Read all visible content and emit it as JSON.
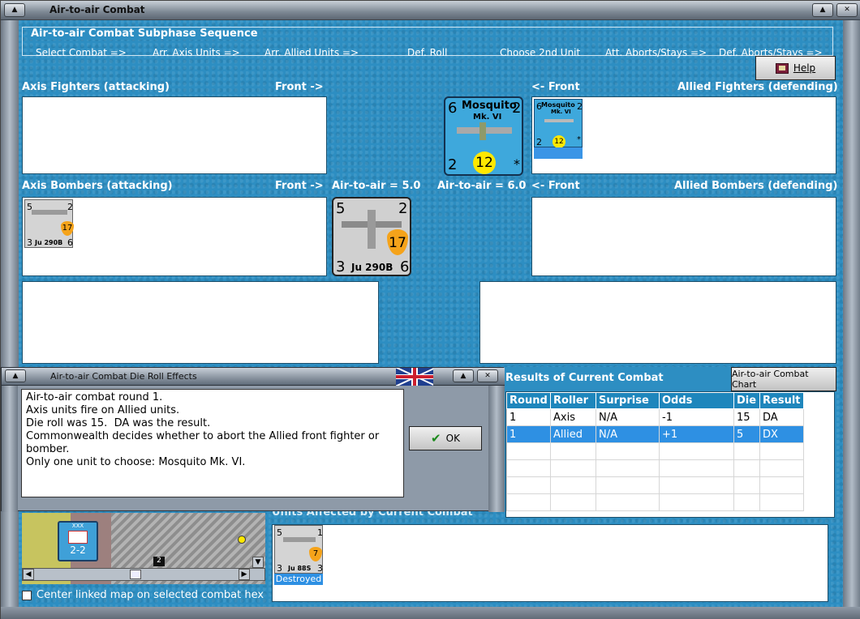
{
  "window": {
    "title": "Air-to-air Combat"
  },
  "sequence": {
    "legend": "Air-to-air Combat Subphase Sequence",
    "steps": [
      "Select Combat =>",
      "Arr. Axis Units =>",
      "Arr. Allied Units =>",
      "Def. Roll",
      "Choose 2nd Unit",
      "Att. Aborts/Stays =>",
      "Def. Aborts/Stays =>"
    ]
  },
  "help": {
    "label": "Help"
  },
  "axis_fighters": {
    "label": "Axis Fighters (attacking)",
    "front": "Front ->"
  },
  "allied_fighters": {
    "label": "Allied Fighters (defending)",
    "front": "<- Front"
  },
  "axis_bombers": {
    "label": "Axis Bombers (attacking)",
    "front": "Front ->",
    "air_to_air": "Air-to-air = 5.0"
  },
  "allied_bombers": {
    "label": "Allied Bombers (defending)",
    "front": "<- Front",
    "air_to_air": "Air-to-air = 6.0"
  },
  "mosquito": {
    "name": "Mosquito",
    "model": "Mk. VI",
    "tl": "6",
    "tr": "2",
    "bl": "2",
    "center": "12",
    "br": "*"
  },
  "ju290": {
    "name": "Ju 290B",
    "tl": "5",
    "tr": "2",
    "bl": "3",
    "center": "17",
    "br": "6"
  },
  "ju88": {
    "name": "Ju 88S",
    "tl": "5",
    "tr": "1",
    "bl": "3",
    "center": "7",
    "br": "3",
    "status": "Destroyed"
  },
  "dialog": {
    "title": "Air-to-air Combat Die Roll Effects",
    "lines": [
      "Air-to-air combat round 1.",
      "Axis units fire on Allied units.",
      "Die roll was 15.  DA was the result.",
      "Commonwealth decides whether to abort the Allied front fighter or bomber.",
      "Only one unit to choose: Mosquito Mk. VI."
    ],
    "ok_label": "OK"
  },
  "results": {
    "title": "Results of Current Combat",
    "chart_button": "Air-to-air Combat Chart",
    "columns": [
      "Round",
      "Roller",
      "Surprise",
      "Odds",
      "Die",
      "Result"
    ],
    "rows": [
      [
        "1",
        "Axis",
        "N/A",
        "-1",
        "15",
        "DA"
      ],
      [
        "1",
        "Allied",
        "N/A",
        "+1",
        "5",
        "DX"
      ]
    ],
    "selected_row": 1
  },
  "map": {
    "unit_top": "XXX",
    "unit_value": "2-2",
    "hex_number": "2"
  },
  "affected": {
    "title": "Units Affected by Current Combat"
  },
  "center_map": {
    "label": "Center linked map on selected combat hex"
  }
}
